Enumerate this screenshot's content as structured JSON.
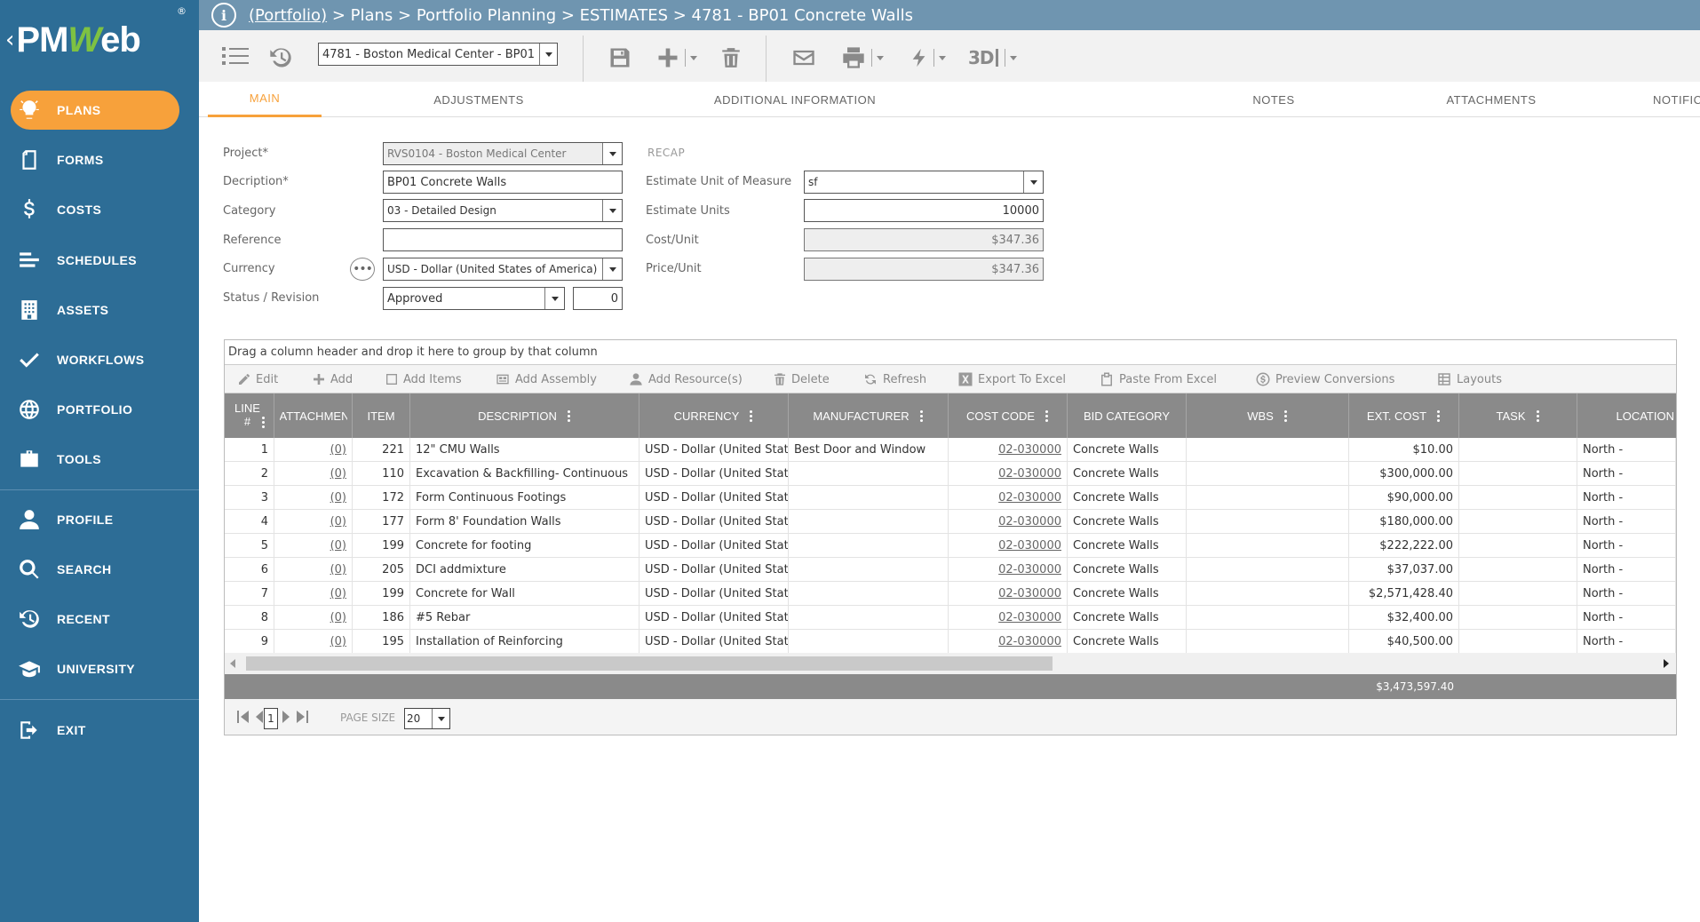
{
  "logo": {
    "back": "‹",
    "text1": "PM",
    "text2": "W",
    "text3": "eb",
    "reg": "®"
  },
  "sidebar": {
    "items": [
      {
        "label": "PLANS",
        "icon": "lightbulb-icon"
      },
      {
        "label": "FORMS",
        "icon": "document-icon"
      },
      {
        "label": "COSTS",
        "icon": "dollar-icon"
      },
      {
        "label": "SCHEDULES",
        "icon": "gantt-icon"
      },
      {
        "label": "ASSETS",
        "icon": "building-icon"
      },
      {
        "label": "WORKFLOWS",
        "icon": "check-icon"
      },
      {
        "label": "PORTFOLIO",
        "icon": "globe-icon"
      },
      {
        "label": "TOOLS",
        "icon": "toolbox-icon"
      },
      {
        "label": "PROFILE",
        "icon": "user-icon"
      },
      {
        "label": "SEARCH",
        "icon": "search-icon"
      },
      {
        "label": "RECENT",
        "icon": "history-icon"
      },
      {
        "label": "UNIVERSITY",
        "icon": "graduation-cap-icon"
      },
      {
        "label": "EXIT",
        "icon": "exit-icon"
      }
    ]
  },
  "breadcrumb": {
    "portfolio": "(Portfolio)",
    "rest": " > Plans > Portfolio Planning > ESTIMATES > 4781 - BP01 Concrete Walls"
  },
  "toolbar": {
    "record_select": "4781 - Boston Medical Center - BP01"
  },
  "tabs": [
    "MAIN",
    "ADJUSTMENTS",
    "ADDITIONAL INFORMATION",
    "NOTES",
    "ATTACHMENTS",
    "NOTIFICATIONS"
  ],
  "form": {
    "project_label": "Project*",
    "project_value": "RVS0104 - Boston Medical Center",
    "description_label": "Decription*",
    "description_value": "BP01 Concrete Walls",
    "category_label": "Category",
    "category_value": "03 - Detailed Design",
    "reference_label": "Reference",
    "reference_value": "",
    "currency_label": "Currency",
    "currency_dots": "•••",
    "currency_value": "USD - Dollar (United States of America)",
    "status_label": "Status / Revision",
    "status_value": "Approved",
    "revision_value": "0",
    "recap_label": "RECAP",
    "uom_label": "Estimate Unit of Measure",
    "uom_value": "sf",
    "units_label": "Estimate Units",
    "units_value": "10000",
    "cost_unit_label": "Cost/Unit",
    "cost_unit_value": "$347.36",
    "price_unit_label": "Price/Unit",
    "price_unit_value": "$347.36"
  },
  "grid": {
    "group_hint": "Drag a column header and drop it here to group by that column",
    "tools": [
      "Edit",
      "Add",
      "Add Items",
      "Add Assembly",
      "Add Resource(s)",
      "Delete",
      "Refresh",
      "Export To Excel",
      "Paste From Excel",
      "Preview Conversions",
      "Layouts"
    ],
    "columns": [
      "LINE #",
      "ATTACHMENTS",
      "ITEM",
      "DESCRIPTION",
      "CURRENCY",
      "MANUFACTURER",
      "COST CODE",
      "BID CATEGORY",
      "WBS",
      "EXT. COST",
      "TASK",
      "LOCATION"
    ],
    "rows": [
      {
        "line": "1",
        "att": "(0)",
        "item": "221",
        "desc": "12\" CMU Walls",
        "cur": "USD - Dollar (United States of America)",
        "mfr": "Best Door and Window",
        "code": "02-030000",
        "bid": "Concrete Walls",
        "wbs": "",
        "ext": "$10.00",
        "task": "",
        "loc": "North -"
      },
      {
        "line": "2",
        "att": "(0)",
        "item": "110",
        "desc": "Excavation & Backfilling- Continuous",
        "cur": "USD - Dollar (United States of America)",
        "mfr": "",
        "code": "02-030000",
        "bid": "Concrete Walls",
        "wbs": "",
        "ext": "$300,000.00",
        "task": "",
        "loc": "North -"
      },
      {
        "line": "3",
        "att": "(0)",
        "item": "172",
        "desc": "Form Continuous Footings",
        "cur": "USD - Dollar (United States of America)",
        "mfr": "",
        "code": "02-030000",
        "bid": "Concrete Walls",
        "wbs": "",
        "ext": "$90,000.00",
        "task": "",
        "loc": "North -"
      },
      {
        "line": "4",
        "att": "(0)",
        "item": "177",
        "desc": "Form 8' Foundation Walls",
        "cur": "USD - Dollar (United States of America)",
        "mfr": "",
        "code": "02-030000",
        "bid": "Concrete Walls",
        "wbs": "",
        "ext": "$180,000.00",
        "task": "",
        "loc": "North -"
      },
      {
        "line": "5",
        "att": "(0)",
        "item": "199",
        "desc": "Concrete for footing",
        "cur": "USD - Dollar (United States of America)",
        "mfr": "",
        "code": "02-030000",
        "bid": "Concrete Walls",
        "wbs": "",
        "ext": "$222,222.00",
        "task": "",
        "loc": "North -"
      },
      {
        "line": "6",
        "att": "(0)",
        "item": "205",
        "desc": "DCI addmixture",
        "cur": "USD - Dollar (United States of America)",
        "mfr": "",
        "code": "02-030000",
        "bid": "Concrete Walls",
        "wbs": "",
        "ext": "$37,037.00",
        "task": "",
        "loc": "North -"
      },
      {
        "line": "7",
        "att": "(0)",
        "item": "199",
        "desc": "Concrete for Wall",
        "cur": "USD - Dollar (United States of America)",
        "mfr": "",
        "code": "02-030000",
        "bid": "Concrete Walls",
        "wbs": "",
        "ext": "$2,571,428.40",
        "task": "",
        "loc": "North -"
      },
      {
        "line": "8",
        "att": "(0)",
        "item": "186",
        "desc": "#5 Rebar",
        "cur": "USD - Dollar (United States of America)",
        "mfr": "",
        "code": "02-030000",
        "bid": "Concrete Walls",
        "wbs": "",
        "ext": "$32,400.00",
        "task": "",
        "loc": "North -"
      },
      {
        "line": "9",
        "att": "(0)",
        "item": "195",
        "desc": "Installation of Reinforcing",
        "cur": "USD - Dollar (United States of America)",
        "mfr": "",
        "code": "02-030000",
        "bid": "Concrete Walls",
        "wbs": "",
        "ext": "$40,500.00",
        "task": "",
        "loc": "North -"
      }
    ],
    "total": "$3,473,597.40",
    "page": "1",
    "page_size_label": "PAGE SIZE",
    "page_size": "20"
  },
  "colors": {
    "sidebar": "#2d6d96",
    "accent": "#f7a13b",
    "topbar": "#6f95b0",
    "grid_header": "#8a8a8a"
  }
}
